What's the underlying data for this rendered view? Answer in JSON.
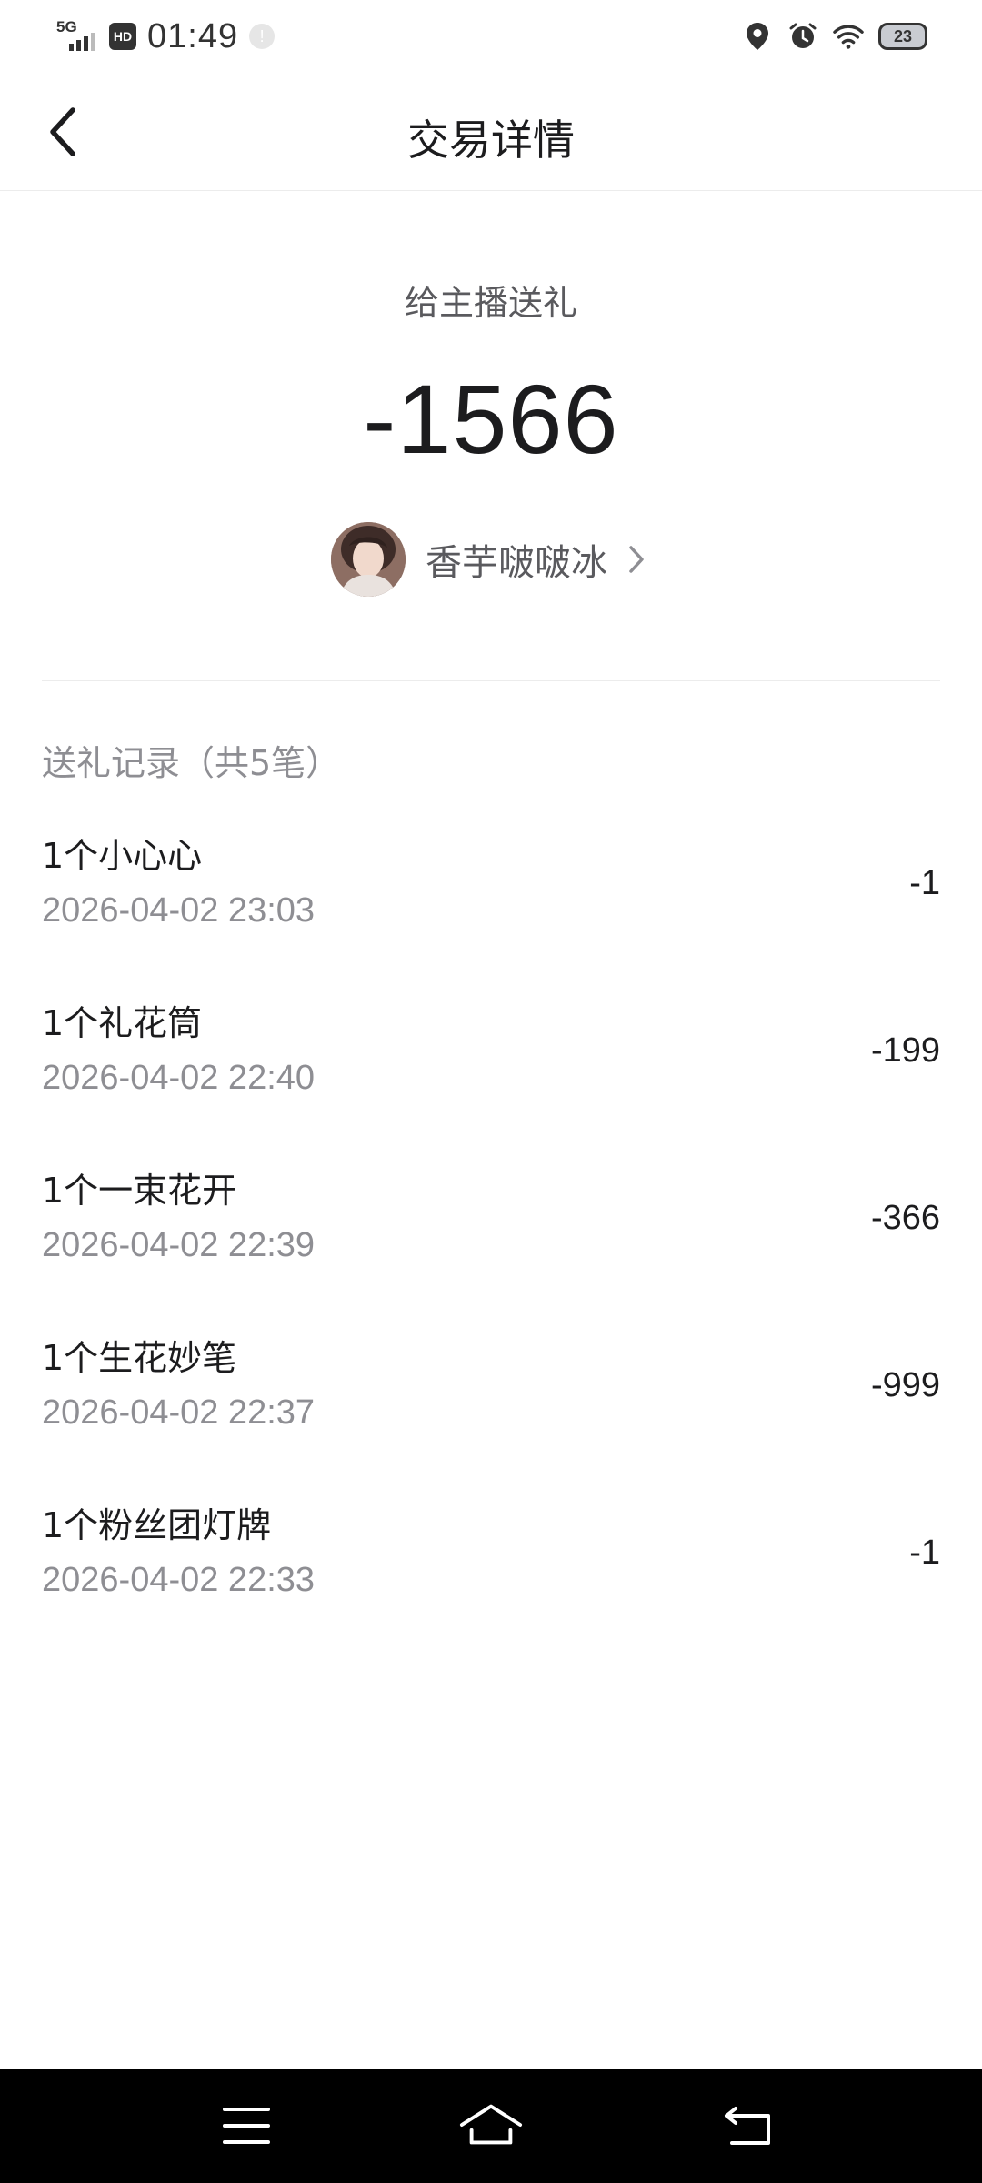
{
  "status_bar": {
    "network": "5G",
    "hd_label": "HD",
    "time": "01:49",
    "battery": "23"
  },
  "header": {
    "title": "交易详情"
  },
  "summary": {
    "label": "给主播送礼",
    "amount": "-1566",
    "streamer_name": "香芋啵啵冰"
  },
  "records": {
    "header": "送礼记录（共5笔）",
    "items": [
      {
        "title": "1个小心心",
        "time": "2026-04-02 23:03",
        "amount": "-1"
      },
      {
        "title": "1个礼花筒",
        "time": "2026-04-02 22:40",
        "amount": "-199"
      },
      {
        "title": "1个一束花开",
        "time": "2026-04-02 22:39",
        "amount": "-366"
      },
      {
        "title": "1个生花妙笔",
        "time": "2026-04-02 22:37",
        "amount": "-999"
      },
      {
        "title": "1个粉丝团灯牌",
        "time": "2026-04-02 22:33",
        "amount": "-1"
      }
    ]
  },
  "icons": {
    "back": "chevron-left-icon",
    "streamer_link": "chevron-right-icon",
    "nav_menu": "menu-icon",
    "nav_home": "home-icon",
    "nav_back": "return-icon"
  }
}
